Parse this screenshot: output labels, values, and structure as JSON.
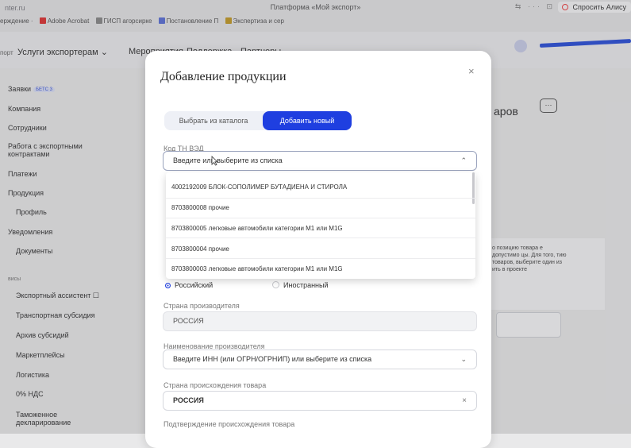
{
  "browser": {
    "url": "nter.ru",
    "title": "Платформа «Мой экспорт»",
    "icons": "⇆ ··· ⊡",
    "ask_button": "Спросить Алису",
    "bookmarks": [
      "ерждение ·",
      "Adobe Acrobat",
      "ГИСП агорсирке",
      "Постановление П",
      "Экспертиза и сер"
    ]
  },
  "site_nav": {
    "left_fragment": "порт",
    "links": [
      "Услуги экспортерам ⌄",
      "Мероприятия",
      "Поддержка",
      "Партнеры"
    ]
  },
  "sidebar": {
    "items": [
      {
        "label": "Заявки",
        "badge": "БЕТС 3"
      },
      {
        "label": "Компания"
      },
      {
        "label": "Сотрудники"
      },
      {
        "label": "Работа с экспортными контрактами"
      },
      {
        "label": "Платежи"
      },
      {
        "label": "Продукция"
      },
      {
        "label": "Профиль"
      },
      {
        "label": "Уведомления"
      },
      {
        "label": "Документы"
      }
    ],
    "section": "висы",
    "services": [
      {
        "label": "Экспортный ассистент ☐"
      },
      {
        "label": "Транспортная субсидия"
      },
      {
        "label": "Архив субсидий"
      },
      {
        "label": "Маркетплейсы"
      },
      {
        "label": "Логистика"
      },
      {
        "label": "0% НДС"
      },
      {
        "label": "Таможенное декларирование"
      }
    ]
  },
  "background": {
    "heading": "аров",
    "dots": "···",
    "hint": "о позицию товара е допустимо цы. Для того, тию товаров, выберите один из ить в проекте"
  },
  "modal": {
    "title": "Добавление продукции",
    "close": "×",
    "tabs": {
      "catalog": "Выбрать из каталога",
      "new": "Добавить новый"
    },
    "tnved": {
      "label": "Код ТН ВЭД",
      "placeholder": "Введите или выберите из списка",
      "options": [
        "4002192009 БЛОК-СОПОЛИМЕР БУТАДИЕНА И СТИРОЛА",
        "8703800008 прочие",
        "8703800005 легковые автомобили категории М1 или M1G",
        "8703800004 прочие",
        "8703800003 легковые автомобили категории М1 или M1G"
      ]
    },
    "origin_type": {
      "russian": "Российский",
      "foreign": "Иностранный"
    },
    "producer_country": {
      "label": "Страна производителя",
      "value": "РОССИЯ"
    },
    "producer_name": {
      "label": "Наименование производителя",
      "placeholder": "Введите ИНН (или ОГРН/ОГРНИП) или выберите из списка"
    },
    "origin_country": {
      "label": "Страна происхождения товара",
      "value": "РОССИЯ"
    },
    "origin_confirm": {
      "label": "Подтверждение происхождения товара"
    }
  },
  "colors": {
    "accent": "#1f3fe0",
    "modal_bg": "#ffffff",
    "page_bg": "#e9e9ea"
  }
}
